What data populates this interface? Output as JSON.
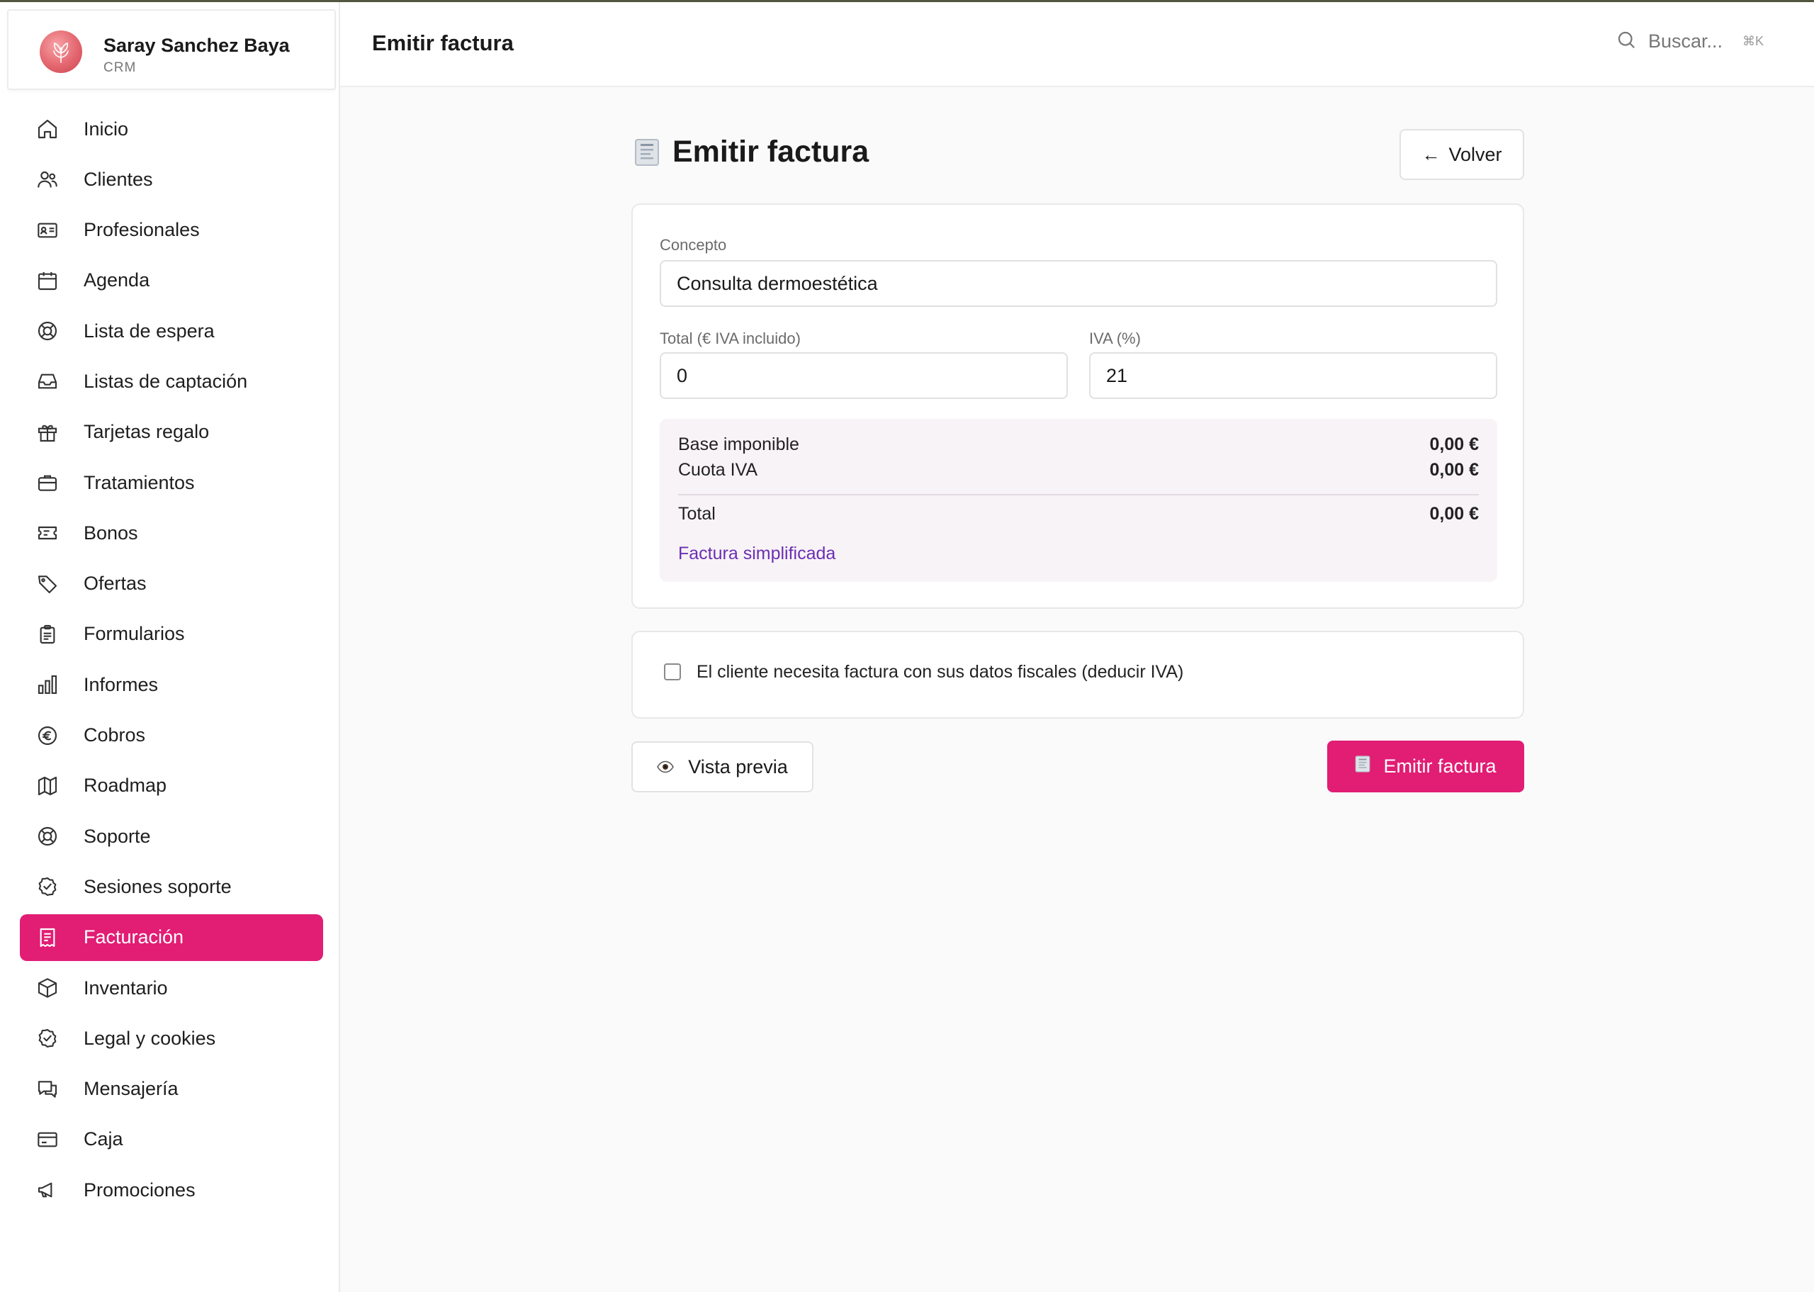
{
  "brand": {
    "name": "Saray Sanchez Baya",
    "subtitle": "CRM"
  },
  "header": {
    "title": "Emitir factura",
    "search_placeholder": "Buscar...",
    "search_shortcut": "⌘K"
  },
  "sidebar": {
    "active_index": 16,
    "items": [
      {
        "label": "Inicio",
        "icon": "home-icon"
      },
      {
        "label": "Clientes",
        "icon": "users-icon"
      },
      {
        "label": "Profesionales",
        "icon": "id-card-icon"
      },
      {
        "label": "Agenda",
        "icon": "calendar-icon"
      },
      {
        "label": "Lista de espera",
        "icon": "lifebuoy-icon"
      },
      {
        "label": "Listas de captación",
        "icon": "inbox-icon"
      },
      {
        "label": "Tarjetas regalo",
        "icon": "gift-icon"
      },
      {
        "label": "Tratamientos",
        "icon": "briefcase-icon"
      },
      {
        "label": "Bonos",
        "icon": "ticket-icon"
      },
      {
        "label": "Ofertas",
        "icon": "tag-icon"
      },
      {
        "label": "Formularios",
        "icon": "clipboard-icon"
      },
      {
        "label": "Informes",
        "icon": "bar-chart-icon"
      },
      {
        "label": "Cobros",
        "icon": "euro-icon"
      },
      {
        "label": "Roadmap",
        "icon": "map-icon"
      },
      {
        "label": "Soporte",
        "icon": "lifebuoy-icon"
      },
      {
        "label": "Sesiones soporte",
        "icon": "badge-check-icon"
      },
      {
        "label": "Facturación",
        "icon": "receipt-icon"
      },
      {
        "label": "Inventario",
        "icon": "box-icon"
      },
      {
        "label": "Legal y cookies",
        "icon": "shield-check-icon"
      },
      {
        "label": "Mensajería",
        "icon": "chat-icon"
      },
      {
        "label": "Caja",
        "icon": "credit-card-icon"
      },
      {
        "label": "Promociones",
        "icon": "megaphone-icon"
      }
    ]
  },
  "main": {
    "heading": "Emitir factura",
    "back_label": "Volver",
    "form": {
      "concepto_label": "Concepto",
      "concepto_value": "Consulta dermoestética",
      "total_label": "Total (€ IVA incluido)",
      "total_value": "0",
      "iva_label": "IVA (%)",
      "iva_value": "21"
    },
    "summary": {
      "base_label": "Base imponible",
      "base_value": "0,00 €",
      "cuota_label": "Cuota IVA",
      "cuota_value": "0,00 €",
      "total_label": "Total",
      "total_value": "0,00 €",
      "type_label": "Factura simplificada"
    },
    "fiscal_checkbox": {
      "label": "El cliente necesita factura con sus datos fiscales (deducir IVA)",
      "checked": false
    },
    "preview_label": "Vista previa",
    "emit_label": "Emitir factura"
  },
  "colors": {
    "accent": "#e11d74",
    "link": "#6b2fb3",
    "summary_bg": "#f8f3f7"
  }
}
